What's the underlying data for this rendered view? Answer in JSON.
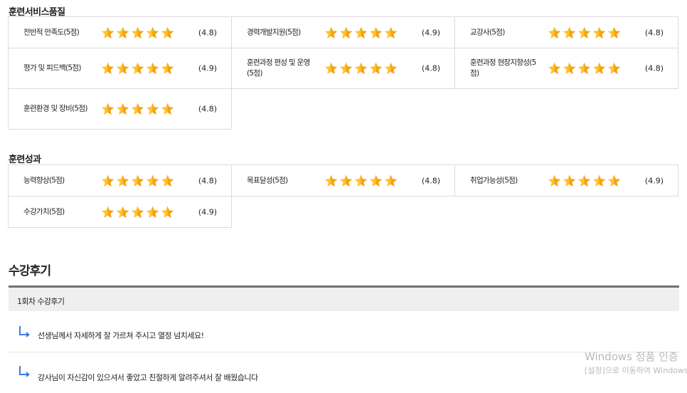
{
  "quality": {
    "title": "훈련서비스품질",
    "rows": [
      [
        {
          "label": "전반적 만족도(5점)",
          "rating": 4.8,
          "score": "(4.8)"
        },
        {
          "label": "경력개발지원(5점)",
          "rating": 4.9,
          "score": "(4.9)"
        },
        {
          "label": "교강사(5점)",
          "rating": 4.8,
          "score": "(4.8)"
        }
      ],
      [
        {
          "label": "평가 및 피드백(5점)",
          "rating": 4.9,
          "score": "(4.9)"
        },
        {
          "label": "훈련과정 편성 및 운영(5점)",
          "rating": 4.8,
          "score": "(4.8)"
        },
        {
          "label": "훈련과정 현장지향성(5점)",
          "rating": 4.8,
          "score": "(4.8)"
        }
      ],
      [
        {
          "label": "훈련환경 및 장비(5점)",
          "rating": 4.8,
          "score": "(4.8)"
        }
      ]
    ]
  },
  "outcome": {
    "title": "훈련성과",
    "rows": [
      [
        {
          "label": "능력향상(5점)",
          "rating": 4.8,
          "score": "(4.8)"
        },
        {
          "label": "목표달성(5점)",
          "rating": 4.8,
          "score": "(4.8)"
        },
        {
          "label": "취업가능성(5점)",
          "rating": 4.9,
          "score": "(4.9)"
        }
      ],
      [
        {
          "label": "수강가치(5점)",
          "rating": 4.9,
          "score": "(4.9)"
        }
      ]
    ]
  },
  "reviews": {
    "title": "수강후기",
    "session_label": "1회차 수강후기",
    "items": [
      "선생님께서 자세하게 잘 가르쳐 주시고 열정 넘치세요!",
      "강사님이 자신감이 있으셔서 좋았고 친절하게 알려주셔서 잘 배웠습니다"
    ]
  },
  "watermark": {
    "line1": "Windows 정품 인증",
    "line2": "[설정]으로 이동하여 Windows"
  },
  "colors": {
    "star_light": "#FFC22E",
    "star_dark": "#F0A416",
    "arrow": "#3A7BE0",
    "review_header_bg": "#EFEFEF",
    "review_header_border": "#707070",
    "grid_border": "#DCDCDC"
  },
  "icons": {
    "rating": "star-icon",
    "reply": "reply-arrow-icon"
  }
}
